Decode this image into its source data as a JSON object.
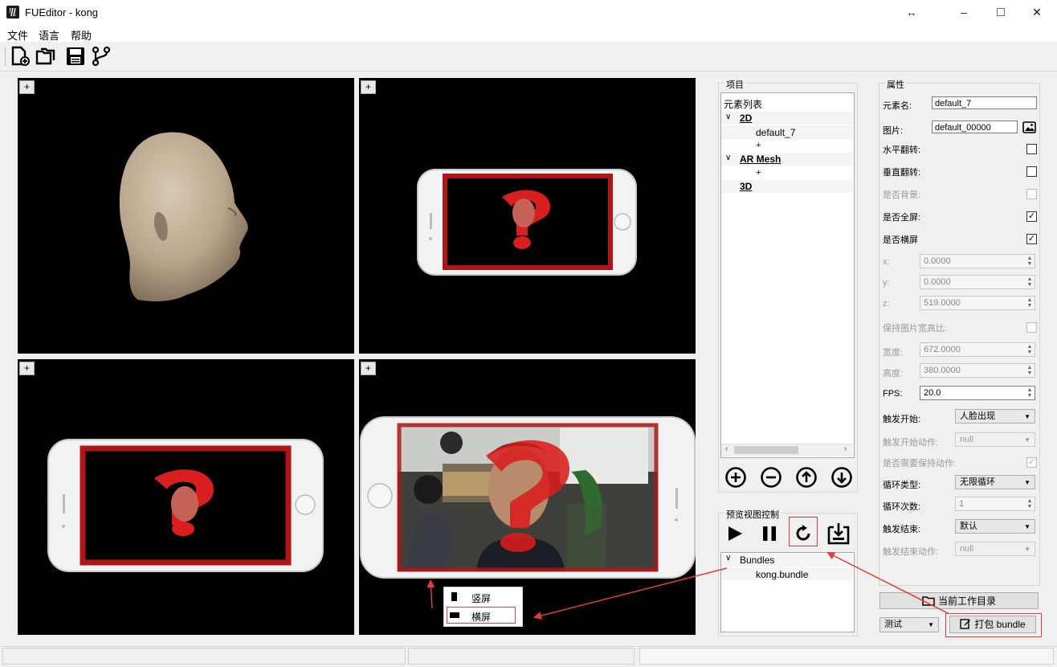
{
  "window": {
    "title": "FUEditor - kong",
    "resize_icon": "↔",
    "minimize": "–",
    "maximize": "□",
    "close": "✕"
  },
  "menu": [
    "文件",
    "语言",
    "帮助"
  ],
  "toolbar": {
    "icons": [
      "new-file-icon",
      "open-folder-icon",
      "save-icon",
      "branch-icon"
    ]
  },
  "viewports": {
    "plus_label": "+"
  },
  "project": {
    "title": "项目",
    "root": "元素列表",
    "groups": [
      {
        "name": "2D",
        "expanded": true,
        "items": [
          "default_7"
        ],
        "add": "+"
      },
      {
        "name": "AR Mesh",
        "expanded": true,
        "items": [],
        "add": "+"
      },
      {
        "name": "3D",
        "expanded": false,
        "items": []
      }
    ],
    "expand_arrow": "∨",
    "action_icons": [
      "add-circle-icon",
      "remove-circle-icon",
      "move-up-icon",
      "move-down-icon"
    ]
  },
  "preview_control": {
    "title": "预览视图控制",
    "icons": [
      "play-icon",
      "pause-icon",
      "rotate-icon",
      "export-icon"
    ],
    "bundles": {
      "title": "Bundles",
      "items": [
        "kong.bundle"
      ]
    },
    "orientation_menu": {
      "portrait": "竖屏",
      "landscape": "横屏"
    }
  },
  "properties": {
    "title": "属性",
    "element_name_label": "元素名:",
    "element_name_value": "default_7",
    "image_label": "图片:",
    "image_value": "default_00000",
    "hflip_label": "水平翻转:",
    "vflip_label": "垂直翻转:",
    "is_background_label": "是否背景:",
    "is_fullscreen_label": "是否全屏:",
    "is_landscape_label": "是否横屏",
    "x_label": "x:",
    "x_value": "0.0000",
    "y_label": "y:",
    "y_value": "0.0000",
    "z_label": "z:",
    "z_value": "519.0000",
    "keep_ratio_label": "保持图片宽高比:",
    "width_label": "宽度:",
    "width_value": "672.0000",
    "height_label": "高度:",
    "height_value": "380.0000",
    "fps_label": "FPS:",
    "fps_value": "20.0",
    "trigger_start_label": "触发开始:",
    "trigger_start_value": "人脸出现",
    "trigger_start_action_label": "触发开始动作:",
    "trigger_start_action_value": "null",
    "need_keep_action_label": "是否需要保持动作:",
    "loop_type_label": "循环类型:",
    "loop_type_value": "无限循环",
    "loop_count_label": "循环次数:",
    "loop_count_value": "1",
    "trigger_end_label": "触发结束:",
    "trigger_end_value": "默认",
    "trigger_end_action_label": "触发结束动作:",
    "trigger_end_action_value": "null",
    "checks": {
      "hflip": false,
      "vflip": false,
      "background": false,
      "fullscreen": true,
      "landscape": true,
      "keep_ratio": false,
      "need_keep": true
    }
  },
  "footer": {
    "workdir_button": "当前工作目录",
    "mode_value": "测试",
    "pack_button": "打包 bundle"
  },
  "colors": {
    "accent_red": "#e23c3c",
    "viewport_bg": "#000000",
    "mask_red": "#cc1f1f"
  }
}
